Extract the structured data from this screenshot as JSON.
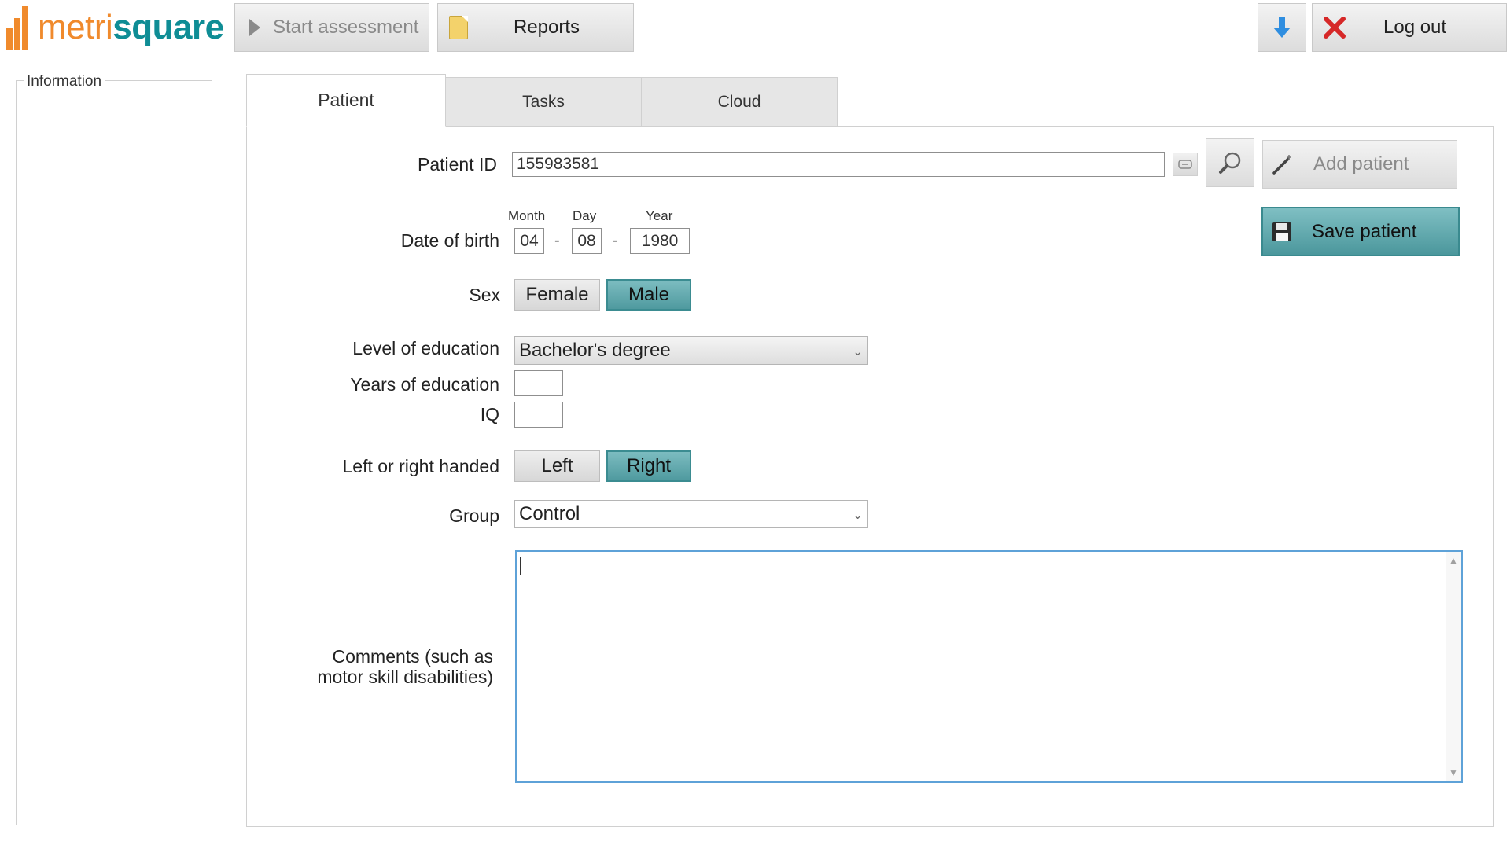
{
  "app": {
    "logo_metri": "metri",
    "logo_square": "square",
    "brand_colors": {
      "orange": "#f08a2c",
      "teal": "#0f8d95"
    }
  },
  "toolbar": {
    "start_assessment": "Start assessment",
    "reports": "Reports",
    "logout": "Log out",
    "icons": [
      "play-icon",
      "document-icon",
      "download-arrow-icon",
      "close-x-icon"
    ]
  },
  "sidebar": {
    "information_label": "Information"
  },
  "tabs": [
    {
      "label": "Patient",
      "active": true
    },
    {
      "label": "Tasks",
      "active": false
    },
    {
      "label": "Cloud",
      "active": false
    }
  ],
  "form": {
    "patient_id_label": "Patient ID",
    "patient_id_value": "155983581",
    "add_patient_label": "Add patient",
    "save_patient_label": "Save patient",
    "dob_label": "Date of birth",
    "dob_month_label": "Month",
    "dob_day_label": "Day",
    "dob_year_label": "Year",
    "dob_month": "04",
    "dob_day": "08",
    "dob_year": "1980",
    "dob_sep": "-",
    "sex_label": "Sex",
    "sex_options": [
      "Female",
      "Male"
    ],
    "sex_selected": "Male",
    "education_level_label": "Level of education",
    "education_level_value": "Bachelor's degree",
    "years_education_label": "Years of education",
    "years_education_value": "",
    "iq_label": "IQ",
    "iq_value": "",
    "handed_label": "Left or right handed",
    "handed_options": [
      "Left",
      "Right"
    ],
    "handed_selected": "Right",
    "group_label": "Group",
    "group_value": "Control",
    "comments_label_line1": "Comments (such as",
    "comments_label_line2": "motor skill disabilities)",
    "comments_value": ""
  },
  "colors": {
    "selected_teal": "#5aa4a9",
    "focus_blue": "#5ea2d8"
  }
}
